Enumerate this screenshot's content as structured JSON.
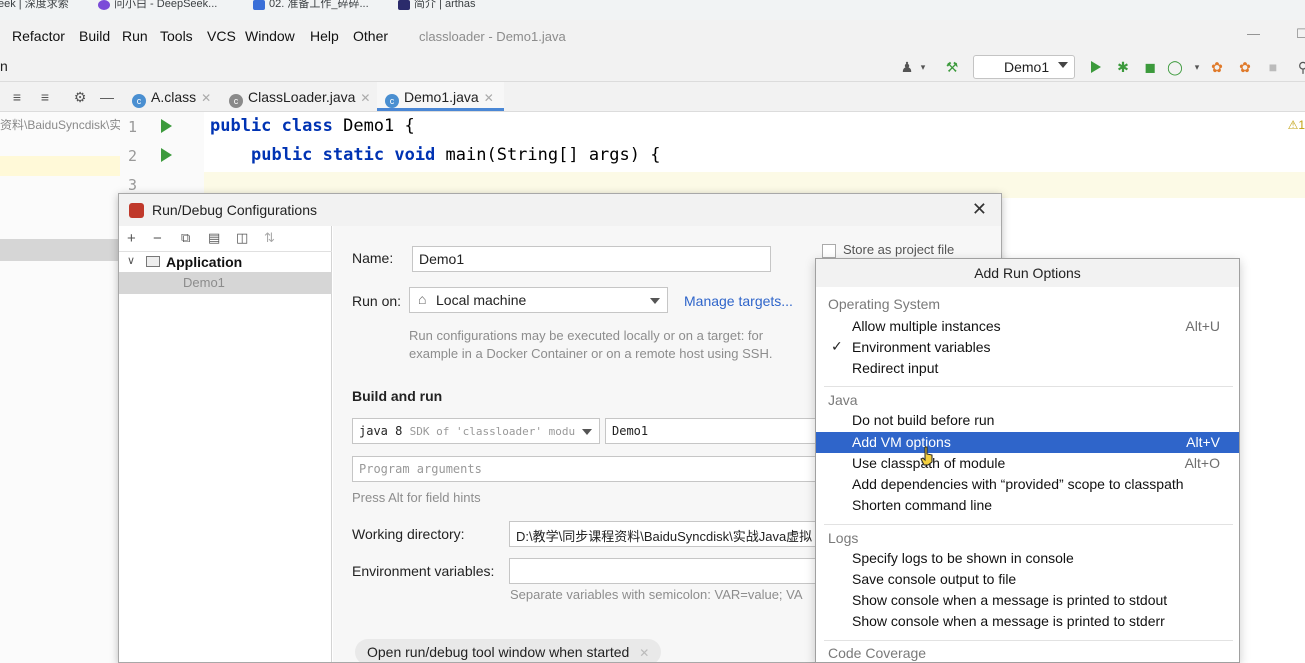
{
  "bookmarks": [
    {
      "label": "eek | 深度求索",
      "color": "#2b5bd7"
    },
    {
      "label": "问小白 - DeepSeek...",
      "color": "#7b4bd8"
    },
    {
      "label": "02. 准备工作_碎碎...",
      "color": "#3a6fd8"
    },
    {
      "label": "简介 | arthas",
      "color": "#2b2b6b"
    }
  ],
  "menubar": {
    "items": [
      "Refactor",
      "Build",
      "Run",
      "Tools",
      "VCS",
      "Window",
      "Help",
      "Other"
    ],
    "window_title": "classloader - Demo1.java"
  },
  "toolbar": {
    "left_char": "n",
    "run_config": "Demo1"
  },
  "tabs": [
    {
      "label": "A.class",
      "active": false
    },
    {
      "label": "ClassLoader.java",
      "active": false
    },
    {
      "label": "Demo1.java",
      "active": true
    }
  ],
  "project": {
    "path_fragment": "资料\\BaiduSyncdisk\\实"
  },
  "editor": {
    "line_numbers": [
      "1",
      "2",
      "3"
    ],
    "lines": [
      {
        "kw1": "public",
        "kw2": "class",
        "rest": " Demo1 {"
      },
      {
        "kw1": "public",
        "kw2": "static",
        "kw3": "void",
        "rest": " main(String[] args) {"
      }
    ],
    "warning": "⚠1"
  },
  "dialog": {
    "title": "Run/Debug Configurations",
    "tree": {
      "group": "Application",
      "item": "Demo1"
    },
    "name_label": "Name:",
    "name_value": "Demo1",
    "store_label": "Store as project file",
    "run_on_label": "Run on:",
    "run_on_value": "Local machine",
    "manage_targets": "Manage targets...",
    "run_on_hint_1": "Run configurations may be executed locally or on a target: for",
    "run_on_hint_2": "example in a Docker Container or on a remote host using SSH.",
    "build_and_run": "Build and run",
    "sdk_value": "java 8",
    "sdk_hint": "SDK of 'classloader' modu",
    "main_class": "Demo1",
    "program_args_placeholder": "Program arguments",
    "field_hints": "Press Alt for field hints",
    "working_dir_label": "Working directory:",
    "working_dir_value": "D:\\教学\\同步课程资料\\BaiduSyncdisk\\实战Java虚拟",
    "env_label": "Environment variables:",
    "env_hint": "Separate variables with semicolon: VAR=value; VA",
    "open_tool_window": "Open run/debug tool window when started"
  },
  "popup": {
    "title": "Add Run Options",
    "groups": [
      {
        "name": "Operating System",
        "items": [
          {
            "label": "Allow multiple instances",
            "shortcut": "Alt+U",
            "checked": false,
            "selected": false
          },
          {
            "label": "Environment variables",
            "shortcut": "",
            "checked": true,
            "selected": false
          },
          {
            "label": "Redirect input",
            "shortcut": "",
            "checked": false,
            "selected": false
          }
        ]
      },
      {
        "name": "Java",
        "items": [
          {
            "label": "Do not build before run",
            "shortcut": "",
            "checked": false,
            "selected": false
          },
          {
            "label": "Add VM options",
            "shortcut": "Alt+V",
            "checked": false,
            "selected": true
          },
          {
            "label": "Use classpath of module",
            "shortcut": "Alt+O",
            "checked": false,
            "selected": false
          },
          {
            "label": "Add dependencies with “provided” scope to classpath",
            "shortcut": "",
            "checked": false,
            "selected": false
          },
          {
            "label": "Shorten command line",
            "shortcut": "",
            "checked": false,
            "selected": false
          }
        ]
      },
      {
        "name": "Logs",
        "items": [
          {
            "label": "Specify logs to be shown in console",
            "shortcut": "",
            "checked": false,
            "selected": false
          },
          {
            "label": "Save console output to file",
            "shortcut": "",
            "checked": false,
            "selected": false
          },
          {
            "label": "Show console when a message is printed to stdout",
            "shortcut": "",
            "checked": false,
            "selected": false
          },
          {
            "label": "Show console when a message is printed to stderr",
            "shortcut": "",
            "checked": false,
            "selected": false
          }
        ]
      },
      {
        "name": "Code Coverage",
        "items": []
      }
    ]
  },
  "colors": {
    "selection": "#2f65ca",
    "run_green": "#3c9a3c",
    "keyword": "#0033b3"
  }
}
